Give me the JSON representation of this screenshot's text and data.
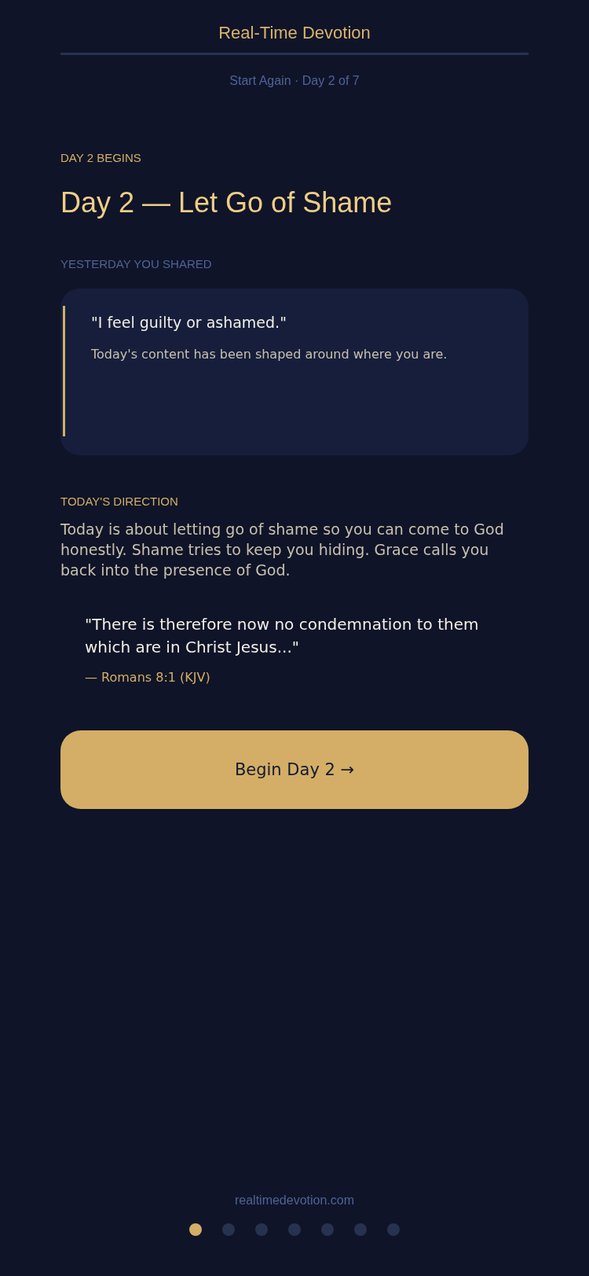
{
  "header": {
    "title": "Real-Time Devotion",
    "subtitle": "Start Again · Day 2 of 7"
  },
  "eyebrow": "DAY 2 BEGINS",
  "heading": "Day 2 — Let Go of Shame",
  "shared": {
    "label": "YESTERDAY YOU SHARED",
    "quote": "\"I feel guilty or ashamed.\"",
    "note": "Today's content has been shaped around where you are."
  },
  "direction": {
    "label": "TODAY'S DIRECTION",
    "text": "Today is about letting go of shame so you can come to God honestly. Shame tries to keep you hiding. Grace calls you back into the presence of God."
  },
  "scripture": {
    "quote": "\"There is therefore now no condemnation to them which are in Christ Jesus...\"",
    "reference": "— Romans 8:1 (KJV)"
  },
  "button": "Begin Day 2 →",
  "footer": "realtimedevotion.com",
  "pager": [
    {
      "selected": true
    },
    {
      "selected": false
    },
    {
      "selected": false
    },
    {
      "selected": false
    },
    {
      "selected": false
    },
    {
      "selected": false
    },
    {
      "selected": false
    }
  ]
}
